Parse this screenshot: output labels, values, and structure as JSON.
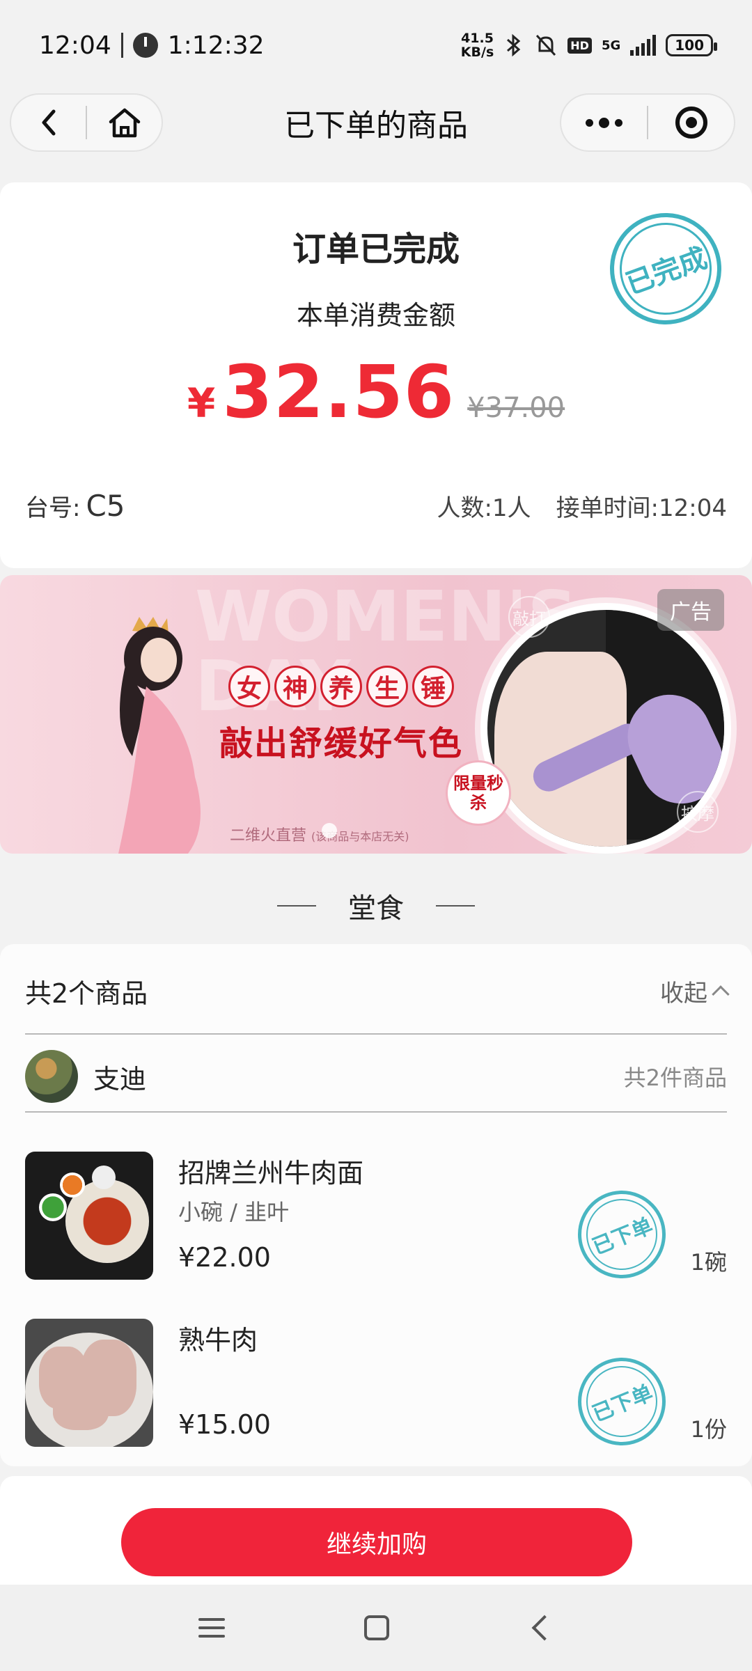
{
  "status_bar": {
    "time": "12:04",
    "timer": "1:12:32",
    "net_speed_top": "41.5",
    "net_speed_bottom": "KB/s",
    "hd": "HD",
    "network": "5G",
    "battery": "100"
  },
  "nav": {
    "title": "已下单的商品"
  },
  "order": {
    "status": "订单已完成",
    "subtitle": "本单消费金额",
    "currency": "¥",
    "amount": "32.56",
    "original_price": "¥37.00",
    "stamp": "已完成",
    "table_label": "台号:",
    "table_value": "C5",
    "people": "人数:1人",
    "accept_time": "接单时间:12:04"
  },
  "ad": {
    "bg_text": "WOMEN'S DAY",
    "title_chars": [
      "女",
      "神",
      "养",
      "生",
      "锤"
    ],
    "subtitle": "敲出舒缓好气色",
    "limited": "限量秒杀",
    "footer": "二维火直营",
    "footer_note": "(该商品与本店无关)",
    "tag": "广告",
    "bubble1": "敲打",
    "bubble2": "按摩"
  },
  "section": {
    "title": "堂食"
  },
  "items": {
    "count_label": "共2个商品",
    "collapse_label": "收起",
    "user": {
      "name": "支迪",
      "total": "共2件商品"
    },
    "list": [
      {
        "name": "招牌兰州牛肉面",
        "spec": "小碗 / 韭叶",
        "price": "¥22.00",
        "qty": "1碗",
        "stamp": "已下单"
      },
      {
        "name": "熟牛肉",
        "spec": "",
        "price": "¥15.00",
        "qty": "1份",
        "stamp": "已下单"
      }
    ]
  },
  "bottom": {
    "continue_label": "继续加购"
  },
  "colors": {
    "accent_red": "#f0243a",
    "price_red": "#ee2a35",
    "stamp_teal": "#3fb2c0"
  }
}
